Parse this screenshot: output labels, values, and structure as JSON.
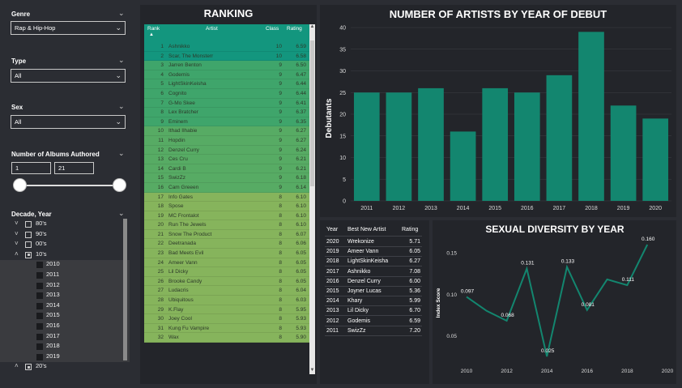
{
  "filters": {
    "genre": {
      "title": "Genre",
      "value": "Rap & Hip-Hop"
    },
    "type": {
      "title": "Type",
      "value": "All"
    },
    "sex": {
      "title": "Sex",
      "value": "All"
    },
    "albums": {
      "title": "Number of Albums Authored",
      "min": "1",
      "max": "21"
    },
    "decade": {
      "title": "Decade, Year",
      "rows": [
        {
          "label": "80's",
          "level": 0,
          "expand": "˅",
          "check": "none"
        },
        {
          "label": "90's",
          "level": 0,
          "expand": "˅",
          "check": "none"
        },
        {
          "label": "00's",
          "level": 0,
          "expand": "˅",
          "check": "none"
        },
        {
          "label": "10's",
          "level": 0,
          "expand": "˄",
          "check": "partial"
        },
        {
          "label": "2010",
          "level": 1,
          "expand": "",
          "check": "none"
        },
        {
          "label": "2011",
          "level": 1,
          "expand": "",
          "check": "none"
        },
        {
          "label": "2012",
          "level": 1,
          "expand": "",
          "check": "none"
        },
        {
          "label": "2013",
          "level": 1,
          "expand": "",
          "check": "none"
        },
        {
          "label": "2014",
          "level": 1,
          "expand": "",
          "check": "none"
        },
        {
          "label": "2015",
          "level": 1,
          "expand": "",
          "check": "none"
        },
        {
          "label": "2016",
          "level": 1,
          "expand": "",
          "check": "none"
        },
        {
          "label": "2017",
          "level": 1,
          "expand": "",
          "check": "none"
        },
        {
          "label": "2018",
          "level": 1,
          "expand": "",
          "check": "none"
        },
        {
          "label": "2019",
          "level": 1,
          "expand": "",
          "check": "none"
        },
        {
          "label": "20's",
          "level": 0,
          "expand": "˄",
          "check": "partial"
        }
      ]
    }
  },
  "ranking": {
    "title": "RANKING",
    "headers": {
      "rank": "Rank",
      "artist": "Artist",
      "class": "Class",
      "rating": "Rating"
    },
    "rows": [
      [
        "1",
        "Ashnikko",
        "10",
        "6.59"
      ],
      [
        "2",
        "Scar, The Monsterr",
        "10",
        "6.58"
      ],
      [
        "3",
        "Jarren Benton",
        "9",
        "6.50"
      ],
      [
        "4",
        "Godemis",
        "9",
        "6.47"
      ],
      [
        "5",
        "LightSkinKeisha",
        "9",
        "6.44"
      ],
      [
        "6",
        "Cognito",
        "9",
        "6.44"
      ],
      [
        "7",
        "G-Mo Skee",
        "9",
        "6.41"
      ],
      [
        "8",
        "Lex Bratcher",
        "9",
        "6.37"
      ],
      [
        "9",
        "Eminem",
        "9",
        "6.35"
      ],
      [
        "10",
        "Ithad Ilhabie",
        "9",
        "6.27"
      ],
      [
        "11",
        "Hopdin",
        "9",
        "6.27"
      ],
      [
        "12",
        "Denzel Curry",
        "9",
        "6.24"
      ],
      [
        "13",
        "Ces Cru",
        "9",
        "6.21"
      ],
      [
        "14",
        "Cardi B",
        "9",
        "6.21"
      ],
      [
        "15",
        "SwizZz",
        "9",
        "6.18"
      ],
      [
        "16",
        "Cam Greeen",
        "9",
        "6.14"
      ],
      [
        "17",
        "Info Gates",
        "8",
        "6.10"
      ],
      [
        "18",
        "Spose",
        "8",
        "6.10"
      ],
      [
        "19",
        "MC Frontalot",
        "8",
        "6.10"
      ],
      [
        "20",
        "Run The Jewels",
        "8",
        "6.10"
      ],
      [
        "21",
        "Snow The Product",
        "8",
        "6.07"
      ],
      [
        "22",
        "Deetranada",
        "8",
        "6.06"
      ],
      [
        "23",
        "Bad Meets Evil",
        "8",
        "6.05"
      ],
      [
        "24",
        "Ameer Vann",
        "8",
        "6.05"
      ],
      [
        "25",
        "Lil Dicky",
        "8",
        "6.05"
      ],
      [
        "26",
        "Brooke Candy",
        "8",
        "6.05"
      ],
      [
        "27",
        "Ludacris",
        "8",
        "6.04"
      ],
      [
        "28",
        "Ubiquitous",
        "8",
        "6.03"
      ],
      [
        "29",
        "K.Flay",
        "8",
        "5.95"
      ],
      [
        "30",
        "Joey Cool",
        "8",
        "5.93"
      ],
      [
        "31",
        "Kung Fu Vampire",
        "8",
        "5.93"
      ],
      [
        "32",
        "Wax",
        "8",
        "5.90"
      ]
    ]
  },
  "best": {
    "headers": {
      "year": "Year",
      "artist": "Best New Artist",
      "rating": "Rating"
    },
    "rows": [
      [
        "2020",
        "Wrekonize",
        "5.71"
      ],
      [
        "2019",
        "Ameer Vann",
        "6.05"
      ],
      [
        "2018",
        "LightSkinKeisha",
        "6.27"
      ],
      [
        "2017",
        "Ashnikko",
        "7.08"
      ],
      [
        "2016",
        "Denzel Curry",
        "6.00"
      ],
      [
        "2015",
        "Joyner Lucas",
        "5.36"
      ],
      [
        "2014",
        "Khary",
        "5.99"
      ],
      [
        "2013",
        "Lil Dicky",
        "6.70"
      ],
      [
        "2012",
        "Godemis",
        "6.59"
      ],
      [
        "2011",
        "SwizZz",
        "7.20"
      ]
    ]
  },
  "chart_data": [
    {
      "type": "bar",
      "title": "NUMBER OF ARTISTS BY YEAR OF DEBUT",
      "xlabel": "",
      "ylabel": "Debutants",
      "categories": [
        "2011",
        "2012",
        "2013",
        "2014",
        "2015",
        "2016",
        "2017",
        "2018",
        "2019",
        "2020"
      ],
      "values": [
        25,
        25,
        26,
        16,
        26,
        25,
        29,
        39,
        22,
        19
      ],
      "ylim": [
        0,
        40
      ],
      "yticks": [
        "0",
        "5",
        "10",
        "15",
        "20",
        "25",
        "30",
        "35",
        "40"
      ],
      "grid": true,
      "color": "#13866f"
    },
    {
      "type": "line",
      "title": "SEXUAL DIVERSITY BY YEAR",
      "xlabel": "",
      "ylabel": "Index Score",
      "x": [
        2010,
        2011,
        2012,
        2013,
        2014,
        2015,
        2016,
        2017,
        2018,
        2019,
        2020
      ],
      "values": [
        0.097,
        0.08,
        0.068,
        0.131,
        0.025,
        0.133,
        0.081,
        0.118,
        0.111,
        0.16
      ],
      "point_labels": [
        "0.097",
        "",
        "0.068",
        "0.131",
        "0.025",
        "0.133",
        "0.081",
        "",
        "0.111",
        "0.160"
      ],
      "xticks": [
        "2010",
        "2012",
        "2014",
        "2016",
        "2018",
        "2020"
      ],
      "ylim": [
        0.025,
        0.16
      ],
      "yticks": [
        "0.05",
        "0.10",
        "0.15"
      ],
      "color": "#13866f"
    }
  ],
  "colors": {
    "teal_header": "#13967e",
    "rank_top": "#13967e",
    "rank_mid": "#3fa56b",
    "rank_low": "#86b45c"
  }
}
